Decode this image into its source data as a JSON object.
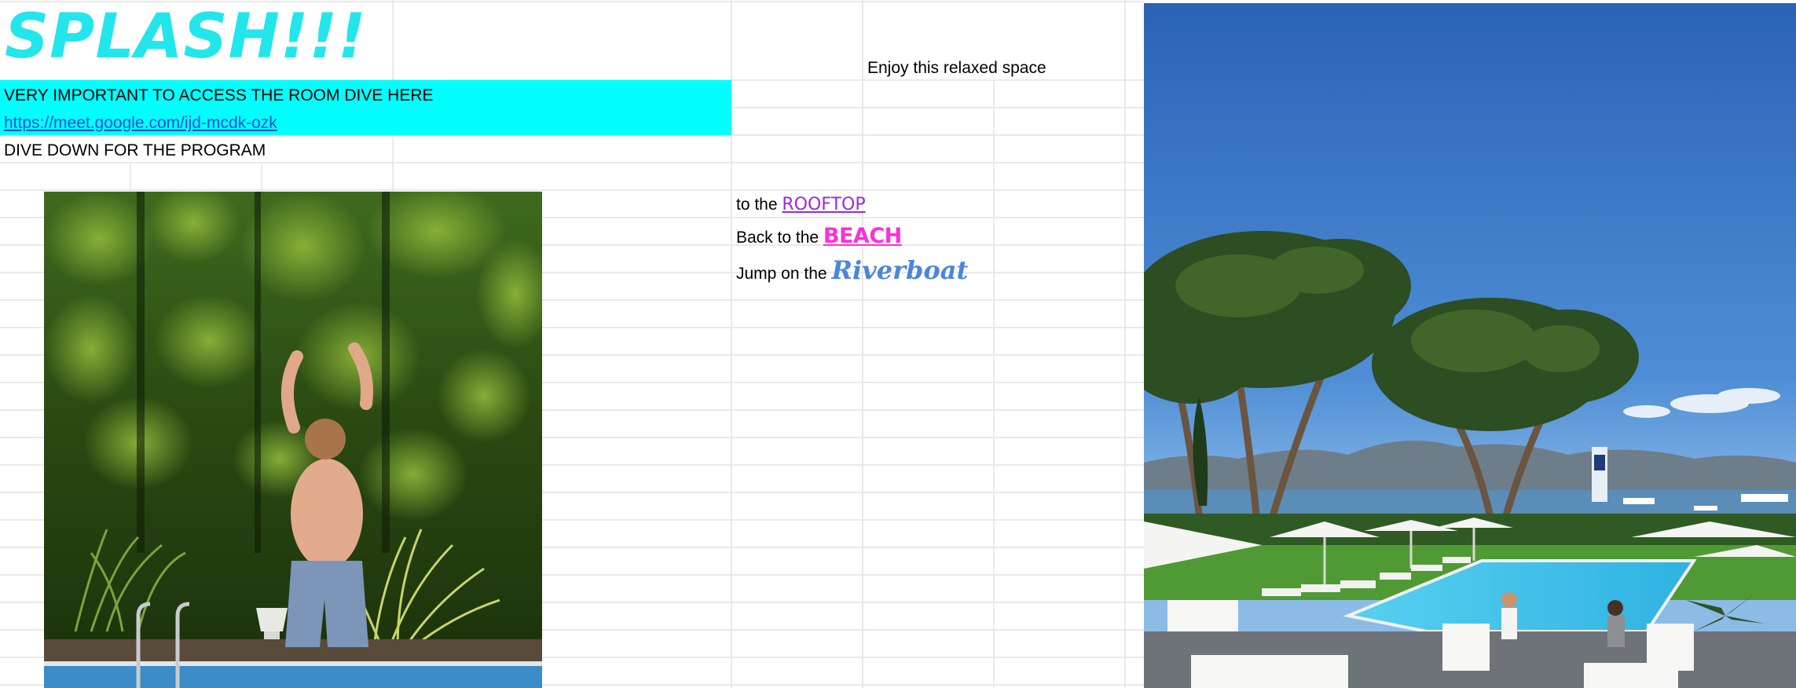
{
  "sheet": {
    "title": "SPLASH!!!",
    "enjoy_text": "Enjoy this relaxed space",
    "important_text": "VERY IMPORTANT TO ACCESS THE ROOM DIVE HERE",
    "meet_link": "https://meet.google.com/ijd-mcdk-ozk",
    "program_text": "DIVE DOWN FOR THE PROGRAM",
    "nav": {
      "rooftop_prefix": "to the",
      "rooftop_label": "ROOFTOP",
      "beach_prefix": "Back to the",
      "beach_label": "BEACH",
      "riverboat_prefix": "Jump on the",
      "riverboat_label": "Riverboat"
    }
  },
  "colors": {
    "title": "#22e6ec",
    "highlight_band": "#00ffff",
    "link": "#1a4fd6",
    "rooftop": "#9b2ad6",
    "beach": "#ff2fd6",
    "riverboat": "#4a86d9",
    "gridline": "#e2e2e2"
  },
  "images": {
    "left_photo": "boy-jumping-into-pool-photo",
    "right_photo": "resort-pool-with-umbrella-pines-photo"
  }
}
